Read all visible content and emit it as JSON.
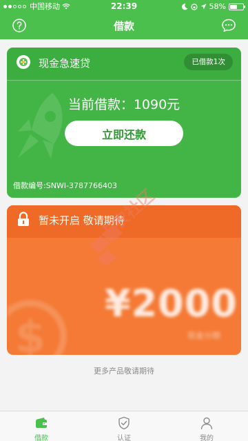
{
  "status_bar": {
    "carrier": "中国移动",
    "time": "22:39",
    "battery": "58%",
    "battery_level": 0.58
  },
  "nav": {
    "title": "借款"
  },
  "loan_card": {
    "title": "现金急速贷",
    "badge": "已借款1次",
    "amount_text": "当前借款：1090元",
    "repay_label": "立即还款",
    "loan_number": "借款编号:SNWI-3787766403"
  },
  "locked_card": {
    "title": "暂未开启 敬请期待",
    "amount": "¥2000",
    "subtitle": "现金分期"
  },
  "watermark": {
    "text": "卡农社区"
  },
  "footer_note": "更多产品敬请期待",
  "tabbar": [
    {
      "label": "借款",
      "icon": "wallet-icon",
      "active": true
    },
    {
      "label": "认证",
      "icon": "shield-icon",
      "active": false
    },
    {
      "label": "我的",
      "icon": "person-icon",
      "active": false
    }
  ],
  "colors": {
    "primary_green": "#4cc04d",
    "card_green": "#43b546",
    "card_orange": "#f47a35",
    "background": "#f3f3f3"
  }
}
